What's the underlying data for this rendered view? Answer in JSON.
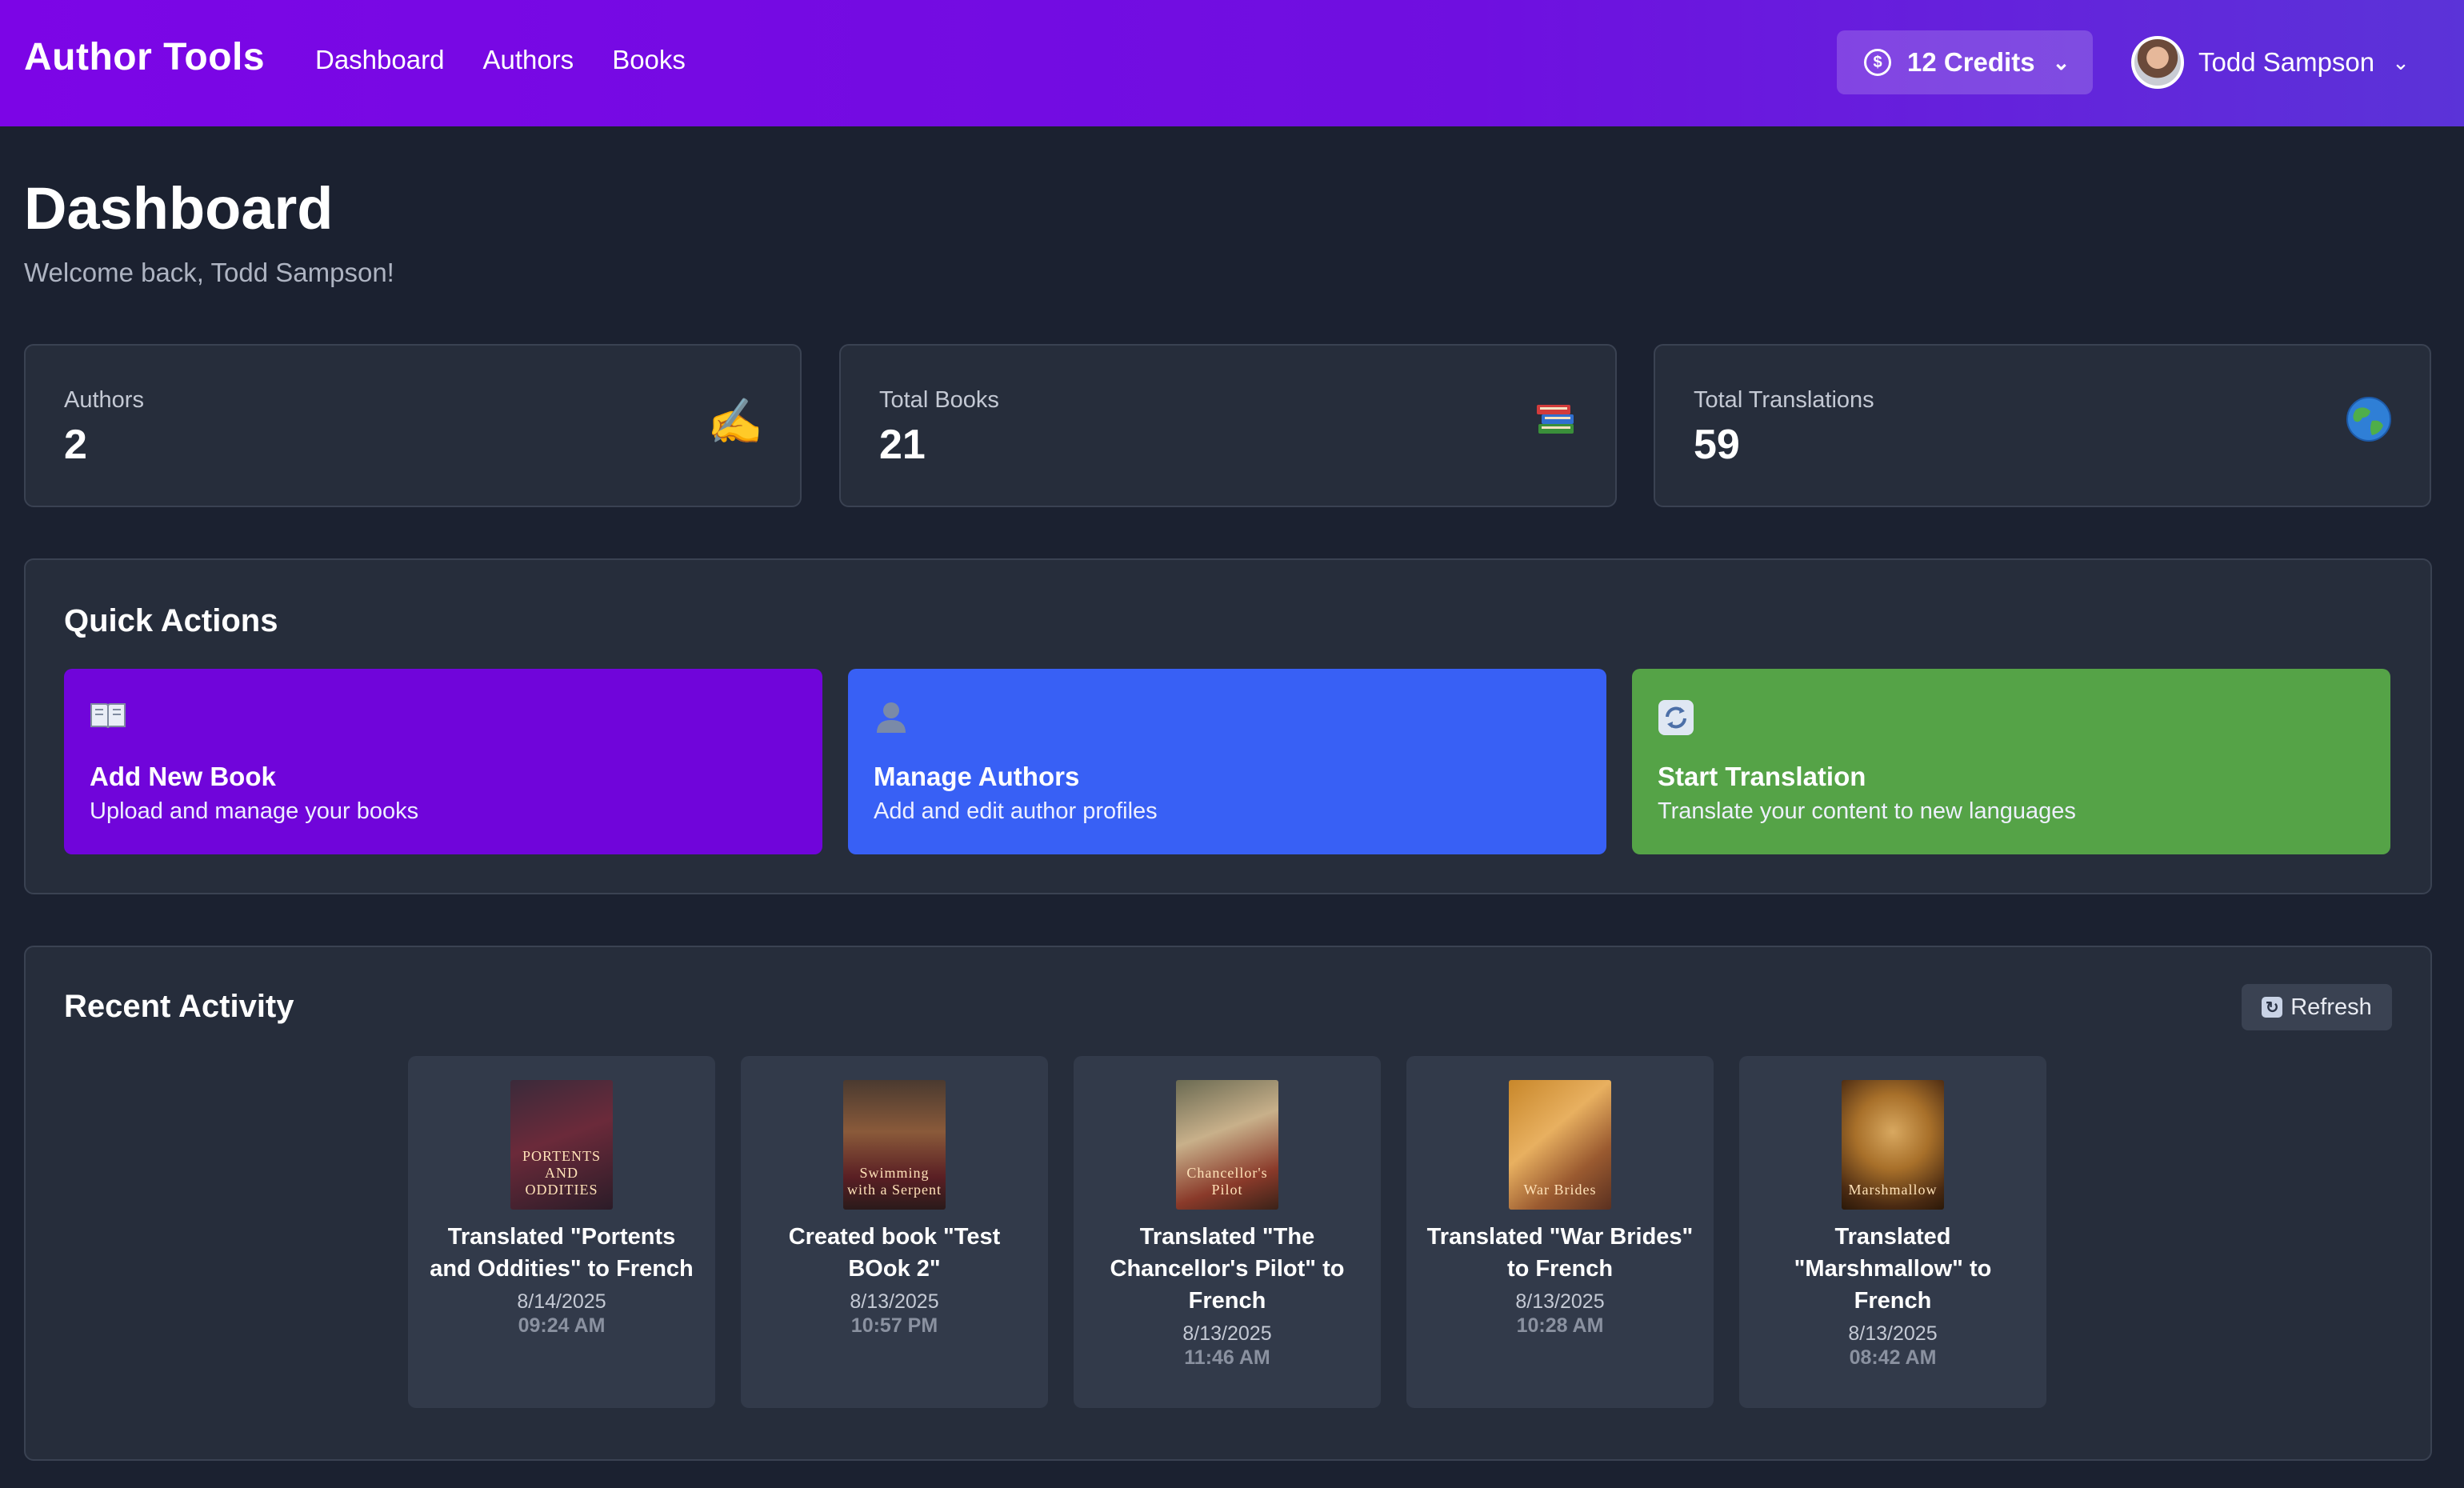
{
  "header": {
    "brand": "Author Tools",
    "nav": [
      "Dashboard",
      "Authors",
      "Books"
    ],
    "credits_label": "12 Credits",
    "user_name": "Todd Sampson"
  },
  "page": {
    "title": "Dashboard",
    "welcome": "Welcome back, Todd Sampson!"
  },
  "stats": [
    {
      "label": "Authors",
      "value": "2",
      "icon": "writing-hand-icon"
    },
    {
      "label": "Total Books",
      "value": "21",
      "icon": "books-icon"
    },
    {
      "label": "Total Translations",
      "value": "59",
      "icon": "globe-icon"
    }
  ],
  "quick_actions": {
    "title": "Quick Actions",
    "items": [
      {
        "title": "Add New Book",
        "subtitle": "Upload and manage your books",
        "icon": "open-book-icon",
        "color": "#7005da"
      },
      {
        "title": "Manage Authors",
        "subtitle": "Add and edit author profiles",
        "icon": "person-icon",
        "color": "#3860f5"
      },
      {
        "title": "Start Translation",
        "subtitle": "Translate your content to new languages",
        "icon": "refresh-icon",
        "color": "#55a347"
      }
    ]
  },
  "recent_activity": {
    "title": "Recent Activity",
    "refresh_label": "Refresh",
    "items": [
      {
        "text": "Translated \"Portents and Oddities\" to French",
        "date": "8/14/2025",
        "time": "09:24 AM",
        "cover_text": "PORTENTS AND ODDITIES"
      },
      {
        "text": "Created book \"Test BOok 2\"",
        "date": "8/13/2025",
        "time": "10:57 PM",
        "cover_text": "Swimming with a Serpent"
      },
      {
        "text": "Translated \"The Chancellor's Pilot\" to French",
        "date": "8/13/2025",
        "time": "11:46 AM",
        "cover_text": "Chancellor's Pilot"
      },
      {
        "text": "Translated \"War Brides\" to French",
        "date": "8/13/2025",
        "time": "10:28 AM",
        "cover_text": "War Brides"
      },
      {
        "text": "Translated \"Marshmallow\" to French",
        "date": "8/13/2025",
        "time": "08:42 AM",
        "cover_text": "Marshmallow"
      }
    ]
  }
}
